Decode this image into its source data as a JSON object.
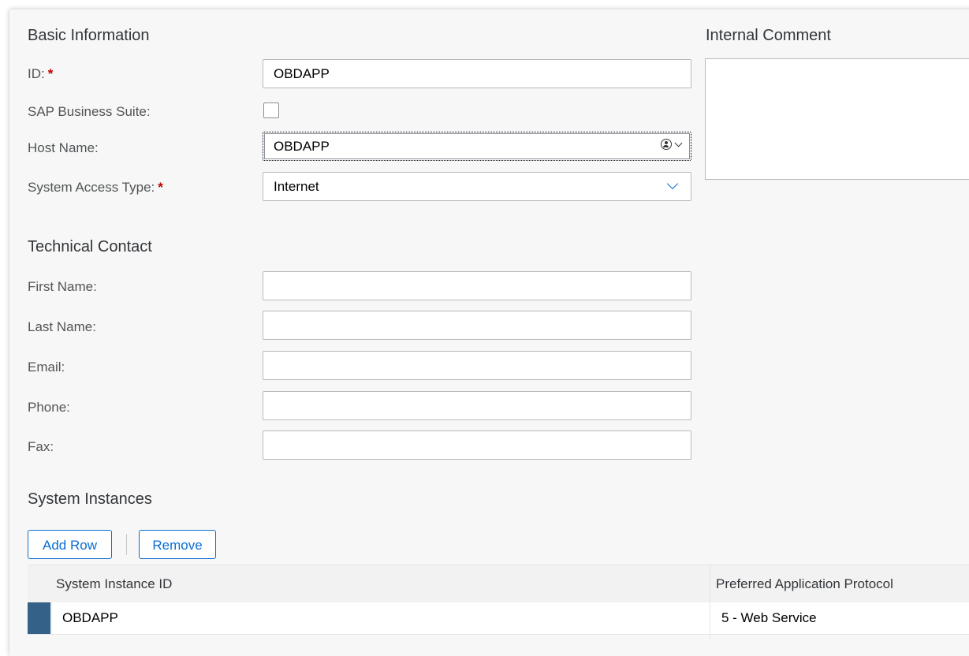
{
  "basic": {
    "title": "Basic Information",
    "id_label": "ID:",
    "id_value": "OBDAPP",
    "suite_label": "SAP Business Suite:",
    "host_label": "Host Name:",
    "host_value": "OBDAPP",
    "access_label": "System Access Type:",
    "access_value": "Internet",
    "required_mark": "*"
  },
  "comment": {
    "title": "Internal Comment",
    "value": ""
  },
  "contact": {
    "title": "Technical Contact",
    "first_name_label": "First Name:",
    "last_name_label": "Last Name:",
    "email_label": "Email:",
    "phone_label": "Phone:",
    "fax_label": "Fax:"
  },
  "instances": {
    "title": "System Instances",
    "add_row_label": "Add Row",
    "remove_label": "Remove",
    "columns": [
      "System Instance ID",
      "Preferred Application Protocol"
    ],
    "rows": [
      {
        "id": "OBDAPP",
        "protocol": "5 - Web Service"
      }
    ]
  },
  "colors": {
    "accent": "#0a6ed1",
    "required": "#bb0000",
    "row_selected": "#346187"
  }
}
